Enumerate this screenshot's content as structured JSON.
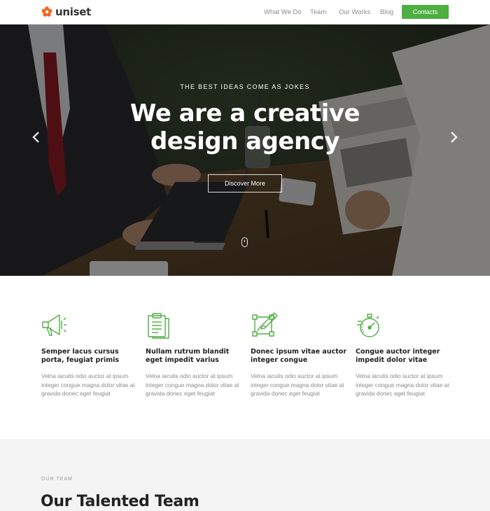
{
  "header": {
    "brand": "uniset",
    "nav": [
      "What We Do",
      "Team",
      "Our Works",
      "Blog"
    ],
    "cta": "Contacts",
    "accent_color": "#4caf3f"
  },
  "hero": {
    "kicker": "THE BEST IDEAS COME AS JOKES",
    "title": "We are a creative design agency",
    "button": "Discover More",
    "prev_icon": "chevron-left-icon",
    "next_icon": "chevron-right-icon",
    "scroll_icon": "mouse-scroll-icon"
  },
  "features": [
    {
      "icon": "megaphone-icon",
      "title": "Semper lacus cursus porta, feugiat primis",
      "text": "Velna iaculis odio auctor at ipsum integer congue magna dolor vitae at gravida donec eget feugiat"
    },
    {
      "icon": "clipboard-icon",
      "title": "Nullam rutrum blandit eget impedit varius",
      "text": "Velna iaculis odio auctor at ipsum integer congue magna dolor vitae at gravida donec eget feugiat"
    },
    {
      "icon": "design-pen-icon",
      "title": "Donec ipsum vitae auctor integer congue",
      "text": "Velna iaculis odio auctor at ipsum integer congue magna dolor vitae at gravida donec eget feugiat"
    },
    {
      "icon": "stopwatch-icon",
      "title": "Congue auctor integer impedit dolor vitae",
      "text": "Velna iaculis odio auctor at ipsum integer congue magna dolor vitae at gravida donec eget feugiat"
    }
  ],
  "team": {
    "kicker": "OUR TEAM",
    "title": "Our Talented Team"
  }
}
